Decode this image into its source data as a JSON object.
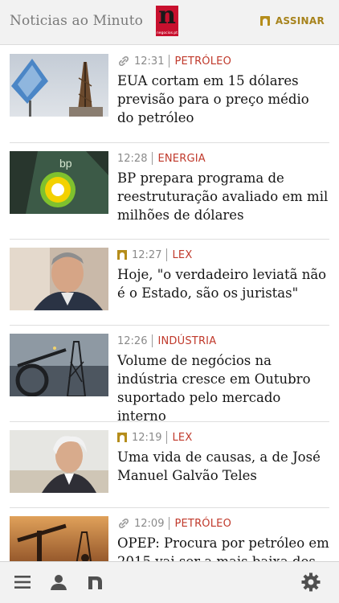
{
  "header": {
    "app_name": "Noticias ao Minuto",
    "logo_letter": "n",
    "logo_sub": "negocios.pt",
    "subscribe_label": "ASSINAR"
  },
  "articles": [
    {
      "icon": "link-icon",
      "time": "12:31",
      "category": "PETRÓLEO",
      "title": "EUA cortam em 15 dólares previsão para o preço médio do petróleo"
    },
    {
      "icon": "",
      "time": "12:28",
      "category": "ENERGIA",
      "title": "BP prepara programa de reestruturação avaliado em mil milhões de dólares"
    },
    {
      "icon": "negocios-n-icon",
      "time": "12:27",
      "category": "LEX",
      "title": "Hoje, \"o verdadeiro leviatã não é o Estado, são os juristas\""
    },
    {
      "icon": "",
      "time": "12:26",
      "category": "INDÚSTRIA",
      "title": "Volume de negócios na indústria cresce em Outubro suportado pelo mercado interno"
    },
    {
      "icon": "negocios-n-icon",
      "time": "12:19",
      "category": "LEX",
      "title": "Uma vida de causas, a de José Manuel Galvão Teles"
    },
    {
      "icon": "link-icon",
      "time": "12:09",
      "category": "PETRÓLEO",
      "title": "OPEP: Procura por petróleo em 2015 vai ser a mais baixa dos"
    }
  ],
  "toolbar": {
    "menu": "menu-icon",
    "profile": "user-icon",
    "brand": "negocios-n-icon",
    "settings": "gear-icon"
  },
  "colors": {
    "category": "#c0392b",
    "accent_gold": "#a7831c",
    "logo_red": "#c8102e"
  }
}
